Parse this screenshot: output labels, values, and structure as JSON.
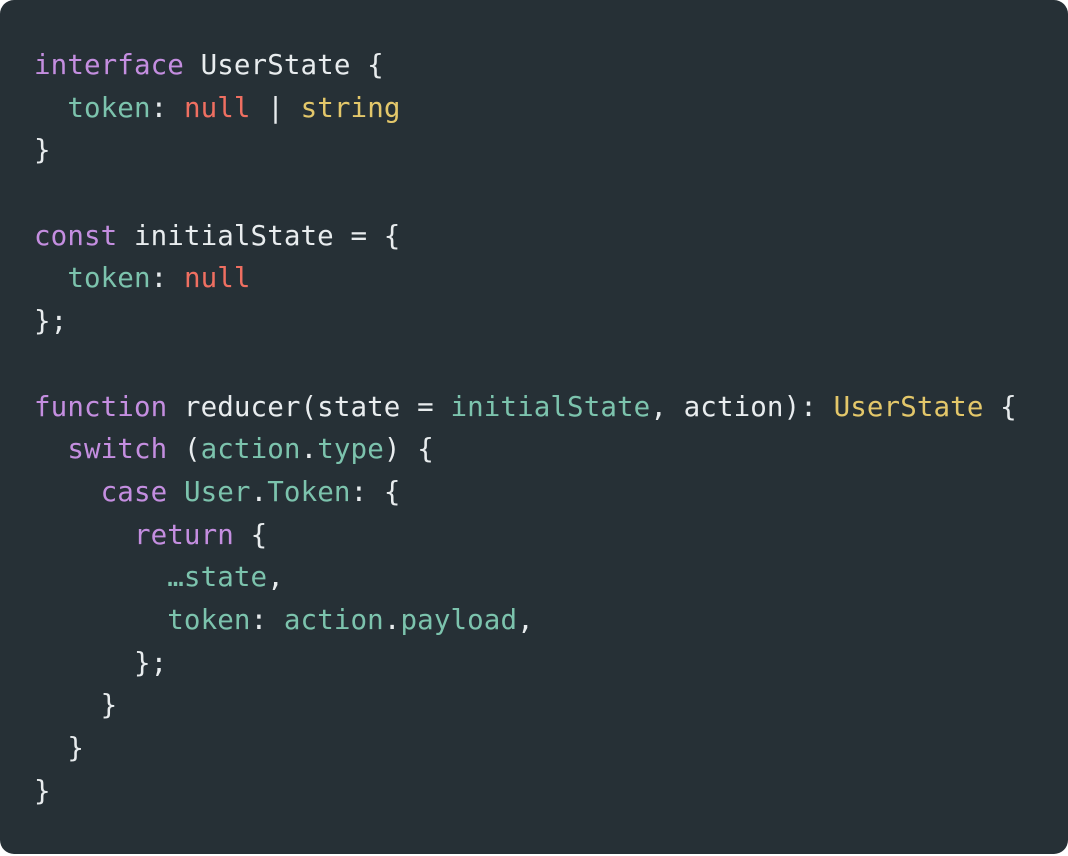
{
  "colors": {
    "background": "#263036",
    "keyword": "#c48ee0",
    "property": "#7cc3ad",
    "null": "#ef6f61",
    "type": "#e3c76a",
    "plain": "#e8ecee"
  },
  "code_lines": [
    [
      {
        "t": "kw",
        "v": "interface"
      },
      {
        "t": "plain",
        "v": " UserState {"
      }
    ],
    [
      {
        "t": "plain",
        "v": "  "
      },
      {
        "t": "prop",
        "v": "token"
      },
      {
        "t": "plain",
        "v": ": "
      },
      {
        "t": "null",
        "v": "null"
      },
      {
        "t": "plain",
        "v": " | "
      },
      {
        "t": "type",
        "v": "string"
      }
    ],
    [
      {
        "t": "plain",
        "v": "}"
      }
    ],
    [],
    [
      {
        "t": "kw",
        "v": "const"
      },
      {
        "t": "plain",
        "v": " initialState = {"
      }
    ],
    [
      {
        "t": "plain",
        "v": "  "
      },
      {
        "t": "prop",
        "v": "token"
      },
      {
        "t": "plain",
        "v": ": "
      },
      {
        "t": "null",
        "v": "null"
      }
    ],
    [
      {
        "t": "plain",
        "v": "};"
      }
    ],
    [],
    [
      {
        "t": "kw",
        "v": "function"
      },
      {
        "t": "plain",
        "v": " reducer(state = "
      },
      {
        "t": "prop",
        "v": "initialState"
      },
      {
        "t": "plain",
        "v": ", action): "
      },
      {
        "t": "type",
        "v": "UserState"
      },
      {
        "t": "plain",
        "v": " {"
      }
    ],
    [
      {
        "t": "plain",
        "v": "  "
      },
      {
        "t": "kw",
        "v": "switch"
      },
      {
        "t": "plain",
        "v": " ("
      },
      {
        "t": "prop",
        "v": "action"
      },
      {
        "t": "plain",
        "v": "."
      },
      {
        "t": "prop",
        "v": "type"
      },
      {
        "t": "plain",
        "v": ") {"
      }
    ],
    [
      {
        "t": "plain",
        "v": "    "
      },
      {
        "t": "kw",
        "v": "case"
      },
      {
        "t": "plain",
        "v": " "
      },
      {
        "t": "prop",
        "v": "User"
      },
      {
        "t": "plain",
        "v": "."
      },
      {
        "t": "prop",
        "v": "Token"
      },
      {
        "t": "plain",
        "v": ": {"
      }
    ],
    [
      {
        "t": "plain",
        "v": "      "
      },
      {
        "t": "kw",
        "v": "return"
      },
      {
        "t": "plain",
        "v": " {"
      }
    ],
    [
      {
        "t": "plain",
        "v": "        "
      },
      {
        "t": "prop",
        "v": "…state"
      },
      {
        "t": "plain",
        "v": ","
      }
    ],
    [
      {
        "t": "plain",
        "v": "        "
      },
      {
        "t": "prop",
        "v": "token"
      },
      {
        "t": "plain",
        "v": ": "
      },
      {
        "t": "prop",
        "v": "action"
      },
      {
        "t": "plain",
        "v": "."
      },
      {
        "t": "prop",
        "v": "payload"
      },
      {
        "t": "plain",
        "v": ","
      }
    ],
    [
      {
        "t": "plain",
        "v": "      };"
      }
    ],
    [
      {
        "t": "plain",
        "v": "    }"
      }
    ],
    [
      {
        "t": "plain",
        "v": "  }"
      }
    ],
    [
      {
        "t": "plain",
        "v": "}"
      }
    ]
  ]
}
